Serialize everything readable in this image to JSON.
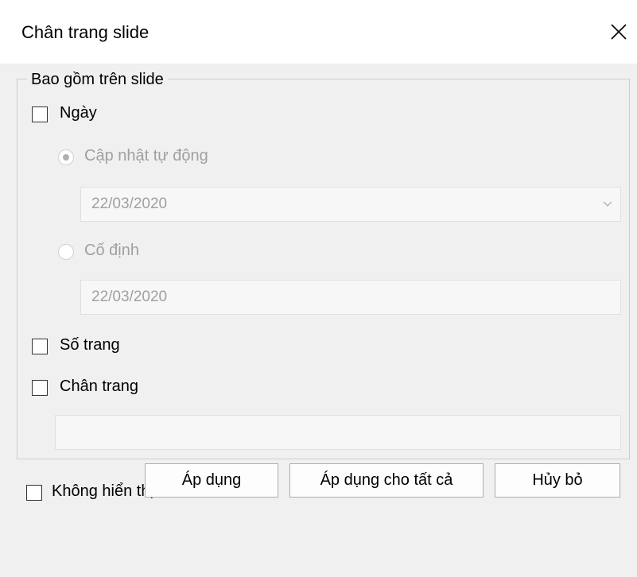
{
  "dialog": {
    "title": "Chân trang slide",
    "close_icon": "close-icon"
  },
  "group": {
    "legend": "Bao gồm trên slide",
    "date": {
      "label": "Ngày",
      "checked": false,
      "auto_update_label": "Cập nhật tự động",
      "auto_update_selected": true,
      "auto_value": "22/03/2020",
      "fixed_label": "Cố định",
      "fixed_selected": false,
      "fixed_value": "22/03/2020"
    },
    "slide_number": {
      "label": "Số trang",
      "checked": false
    },
    "footer": {
      "label": "Chân trang",
      "checked": false,
      "value": ""
    }
  },
  "dont_show_on_title": {
    "label": "Không hiển thị trên slide tiêu đề",
    "checked": false
  },
  "buttons": {
    "apply": "Áp dụng",
    "apply_all": "Áp dụng cho tất cả",
    "cancel": "Hủy bỏ"
  }
}
